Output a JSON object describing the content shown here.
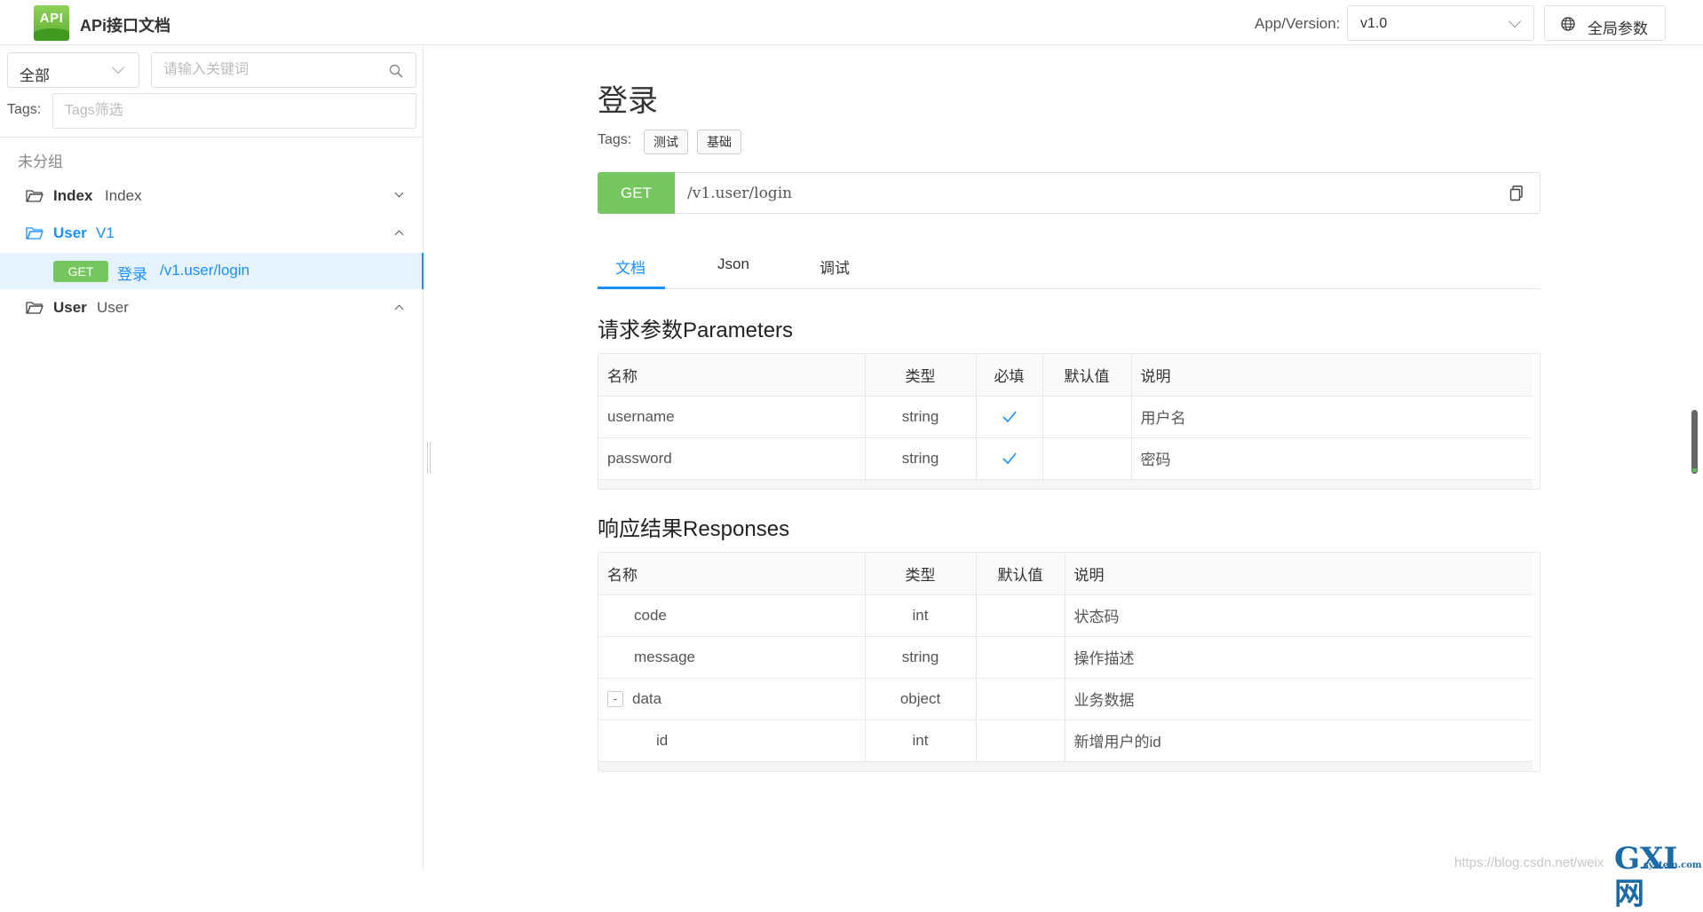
{
  "header": {
    "app_title": "APi接口文档",
    "logo_text": "API",
    "version_label": "App/Version:",
    "version_value": "v1.0",
    "global_params_label": "全局参数"
  },
  "sidebar": {
    "filter_value": "全部",
    "search_placeholder": "请输入关键词",
    "tags_label": "Tags:",
    "tags_placeholder": "Tags筛选",
    "ungrouped_label": "未分组",
    "groups": [
      {
        "name": "Index",
        "desc": "Index",
        "expanded": false
      },
      {
        "name": "User",
        "desc": "V1",
        "expanded": true
      },
      {
        "name": "User",
        "desc": "User",
        "expanded": true
      }
    ],
    "active_api": {
      "method": "GET",
      "name": "登录",
      "path": "/v1.user/login"
    }
  },
  "main": {
    "title": "登录",
    "tags_label": "Tags:",
    "tags": [
      "测试",
      "基础"
    ],
    "method": "GET",
    "url": "/v1.user/login",
    "tabs": [
      "文档",
      "Json",
      "调试"
    ],
    "active_tab": "文档",
    "params_title": "请求参数Parameters",
    "params_headers": [
      "名称",
      "类型",
      "必填",
      "默认值",
      "说明"
    ],
    "params_rows": [
      {
        "name": "username",
        "type": "string",
        "required": true,
        "default": "",
        "desc": "用户名"
      },
      {
        "name": "password",
        "type": "string",
        "required": true,
        "default": "",
        "desc": "密码"
      }
    ],
    "responses_title": "响应结果Responses",
    "responses_headers": [
      "名称",
      "类型",
      "默认值",
      "说明"
    ],
    "responses_rows": [
      {
        "name": "code",
        "type": "int",
        "default": "",
        "desc": "状态码",
        "level": 1,
        "expandable": false
      },
      {
        "name": "message",
        "type": "string",
        "default": "",
        "desc": "操作描述",
        "level": 1,
        "expandable": false
      },
      {
        "name": "data",
        "type": "object",
        "default": "",
        "desc": "业务数据",
        "level": 1,
        "expandable": true,
        "expand_symbol": "-"
      },
      {
        "name": "id",
        "type": "int",
        "default": "",
        "desc": "新增用户的id",
        "level": 2,
        "expandable": false
      }
    ]
  },
  "watermark": {
    "text": "https://blog.csdn.net/weix",
    "logo": "GXI网",
    "logo_small": "system.com"
  },
  "colors": {
    "accent": "#1890ff",
    "method_get": "#76c65f",
    "border": "#e6e6e6"
  }
}
